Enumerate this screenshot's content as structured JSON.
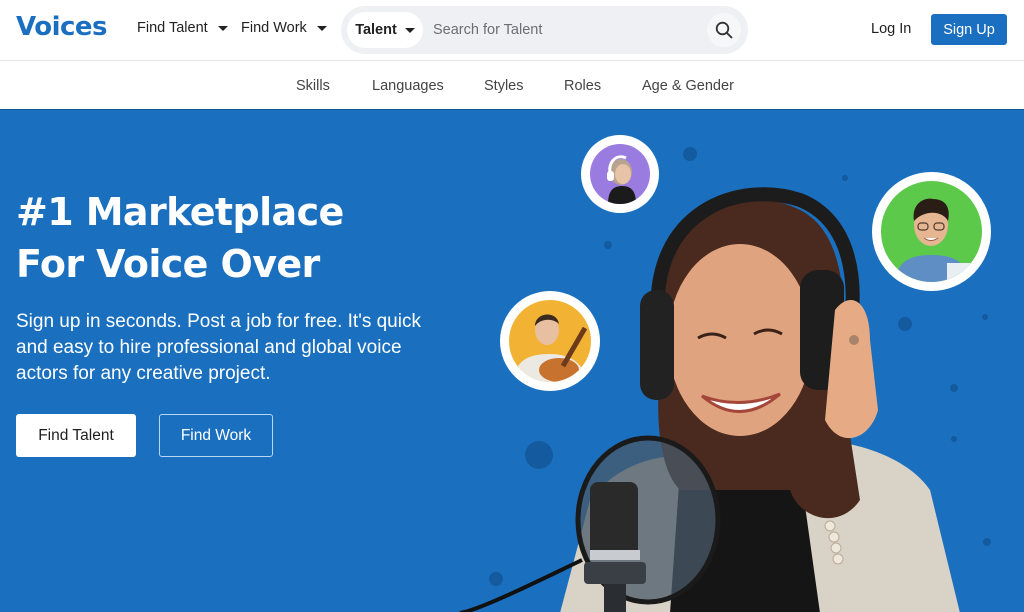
{
  "header": {
    "logo": "Voices",
    "nav": [
      {
        "label": "Find Talent",
        "icon": "caret-down-icon"
      },
      {
        "label": "Find Work",
        "icon": "caret-down-icon"
      }
    ],
    "search": {
      "scope": "Talent",
      "placeholder": "Search for Talent",
      "value": "",
      "icon": "search-icon"
    },
    "login_label": "Log In",
    "signup_label": "Sign Up"
  },
  "subnav": {
    "items": [
      "Skills",
      "Languages",
      "Styles",
      "Roles",
      "Age & Gender"
    ]
  },
  "hero": {
    "title_line1": "#1 Marketplace",
    "title_line2": "For Voice Over",
    "subtitle": "Sign up in seconds. Post a job for free. It's quick and easy to hire professional and global voice actors for any creative project.",
    "primary_button": "Find Talent",
    "secondary_button": "Find Work",
    "avatars": [
      {
        "name": "voice-actor-headphones-woman",
        "bg": "#9a7be0"
      },
      {
        "name": "voice-actor-glasses-man",
        "bg": "#5cc94a"
      },
      {
        "name": "voice-actor-guitar-man",
        "bg": "#f2b233"
      }
    ]
  },
  "colors": {
    "brand": "#1a6fc0",
    "hero_bg": "#1a70bf",
    "search_bg": "#eef0f3"
  }
}
